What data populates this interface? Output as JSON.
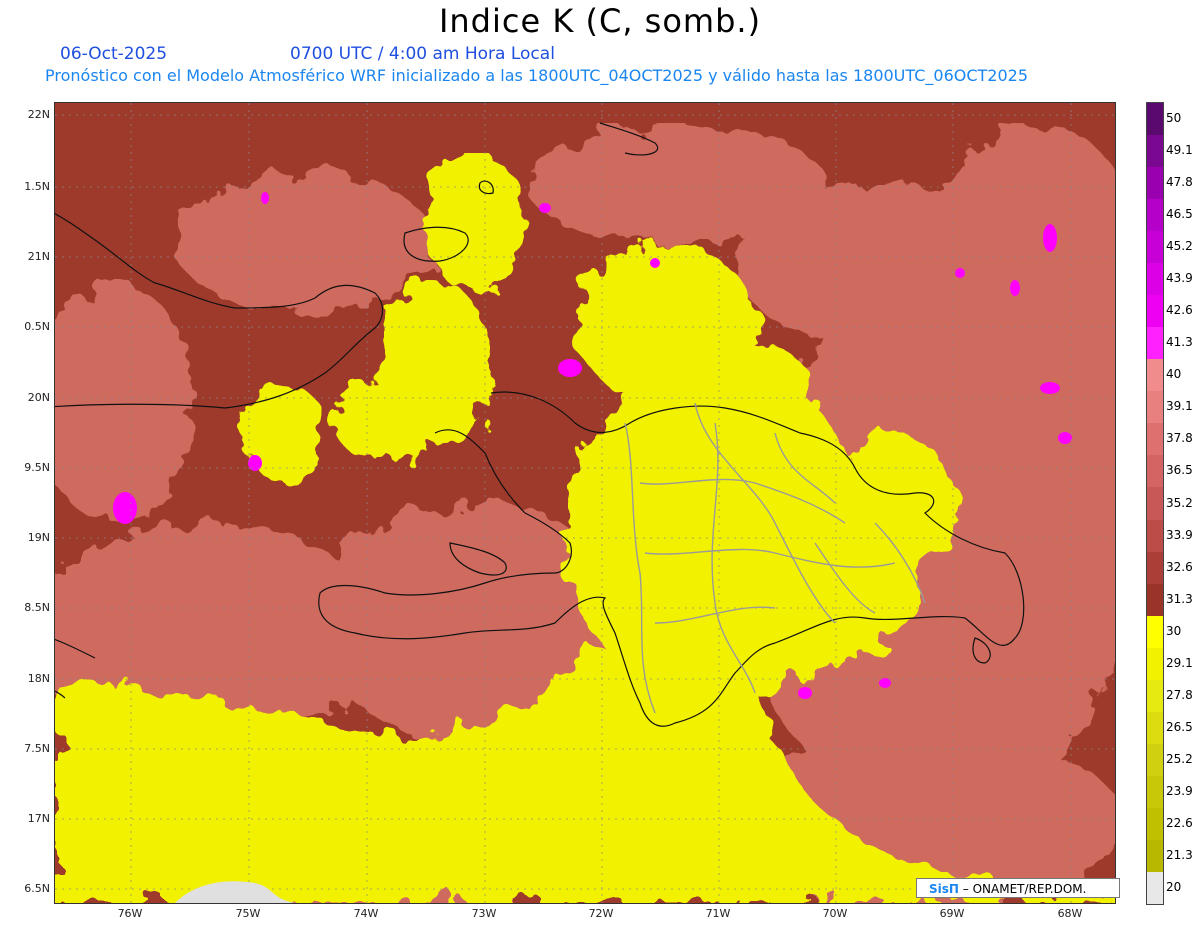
{
  "header": {
    "title": "Indice K (C, somb.)",
    "date": "06-Oct-2025",
    "time": "0700 UTC / 4:00 am Hora Local",
    "forecast": "Pronóstico con el Modelo Atmosférico WRF inicializado a las 1800UTC_04OCT2025 y válido hasta las  1800UTC_06OCT2025"
  },
  "axes": {
    "lat_labels": [
      "22N",
      "1.5N",
      "21N",
      "0.5N",
      "20N",
      "9.5N",
      "19N",
      "8.5N",
      "18N",
      "7.5N",
      "17N",
      "6.5N"
    ],
    "lon_labels": [
      "76W",
      "75W",
      "74W",
      "73W",
      "72W",
      "71W",
      "70W",
      "69W",
      "68W"
    ]
  },
  "colorbar": {
    "labels": [
      "50",
      "49.1",
      "47.8",
      "46.5",
      "45.2",
      "43.9",
      "42.6",
      "41.3",
      "40",
      "39.1",
      "37.8",
      "36.5",
      "35.2",
      "33.9",
      "32.6",
      "31.3",
      "30",
      "29.1",
      "27.8",
      "26.5",
      "25.2",
      "23.9",
      "22.6",
      "21.3",
      "20"
    ],
    "colors": [
      "#5a0a6e",
      "#7a0890",
      "#9a00b0",
      "#b400c8",
      "#c800d8",
      "#dc00e6",
      "#ee00f2",
      "#ff22ff",
      "#f08c8c",
      "#e88080",
      "#de7070",
      "#d46464",
      "#c85858",
      "#bb4c48",
      "#ab3e36",
      "#9b3428",
      "#ffff00",
      "#f2f200",
      "#e6ea10",
      "#dcdc10",
      "#d0d010",
      "#c8c808",
      "#c0c000",
      "#b8b800",
      "#e8e8e8"
    ]
  },
  "credit": {
    "brand": "SisΠ",
    "text": " – ONAMET/REP.DOM."
  }
}
